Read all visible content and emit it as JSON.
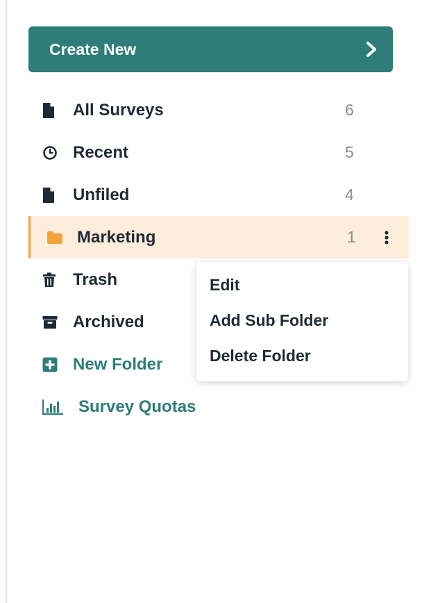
{
  "create_button": {
    "label": "Create New",
    "icon": "chevron-right-icon"
  },
  "sidebar": {
    "items": [
      {
        "label": "All Surveys",
        "count": "6",
        "icon": "file-icon"
      },
      {
        "label": "Recent",
        "count": "5",
        "icon": "clock-icon"
      },
      {
        "label": "Unfiled",
        "count": "4",
        "icon": "file-icon"
      },
      {
        "label": "Marketing",
        "count": "1",
        "icon": "folder-icon",
        "active": true
      },
      {
        "label": "Trash",
        "icon": "trash-icon"
      },
      {
        "label": "Archived",
        "icon": "archive-icon"
      },
      {
        "label": "New Folder",
        "icon": "plus-square-icon"
      },
      {
        "label": "Survey Quotas",
        "icon": "bar-chart-icon"
      }
    ]
  },
  "context_menu": {
    "items": [
      {
        "label": "Edit"
      },
      {
        "label": "Add Sub Folder"
      },
      {
        "label": "Delete Folder"
      }
    ]
  },
  "colors": {
    "accent": "#2e7d78",
    "active_bg": "#fdeedc",
    "active_border": "#f7a03e",
    "folder": "#f7a03e",
    "text": "#1f2a36",
    "muted": "#8c8c8c"
  }
}
